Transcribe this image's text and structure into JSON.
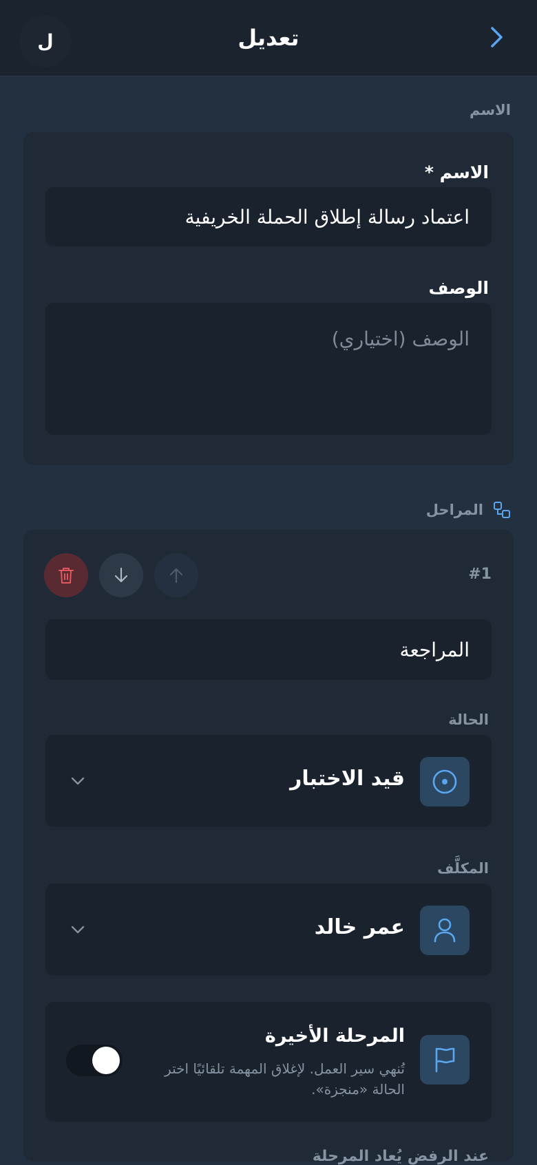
{
  "header": {
    "title": "تعديل",
    "avatar_initial": "ل"
  },
  "name_section": {
    "label": "الاسم",
    "name_field": {
      "label": "الاسم *",
      "value": "اعتماد رسالة إطلاق الحملة الخريفية"
    },
    "description_field": {
      "label": "الوصف",
      "placeholder": "الوصف (اختياري)"
    }
  },
  "stages_section": {
    "label": "المراحل",
    "stage": {
      "number": "#1",
      "name_value": "المراجعة",
      "status": {
        "label": "الحالة",
        "value": "قيد الاختبار"
      },
      "assignee": {
        "label": "المكلَّف",
        "value": "عمر خالد"
      },
      "final_stage": {
        "title": "المرحلة الأخيرة",
        "description": "تُنهي سير العمل. لإغلاق المهمة تلقائيًا اختر الحالة «منجزة».",
        "enabled": true
      }
    },
    "next_label": "عند الرفض يُعاد المرحلة"
  },
  "colors": {
    "accent": "#5aa7f0",
    "danger": "#e2585e",
    "background": "#233040",
    "card": "#1f2a36",
    "input": "#1a232d"
  }
}
